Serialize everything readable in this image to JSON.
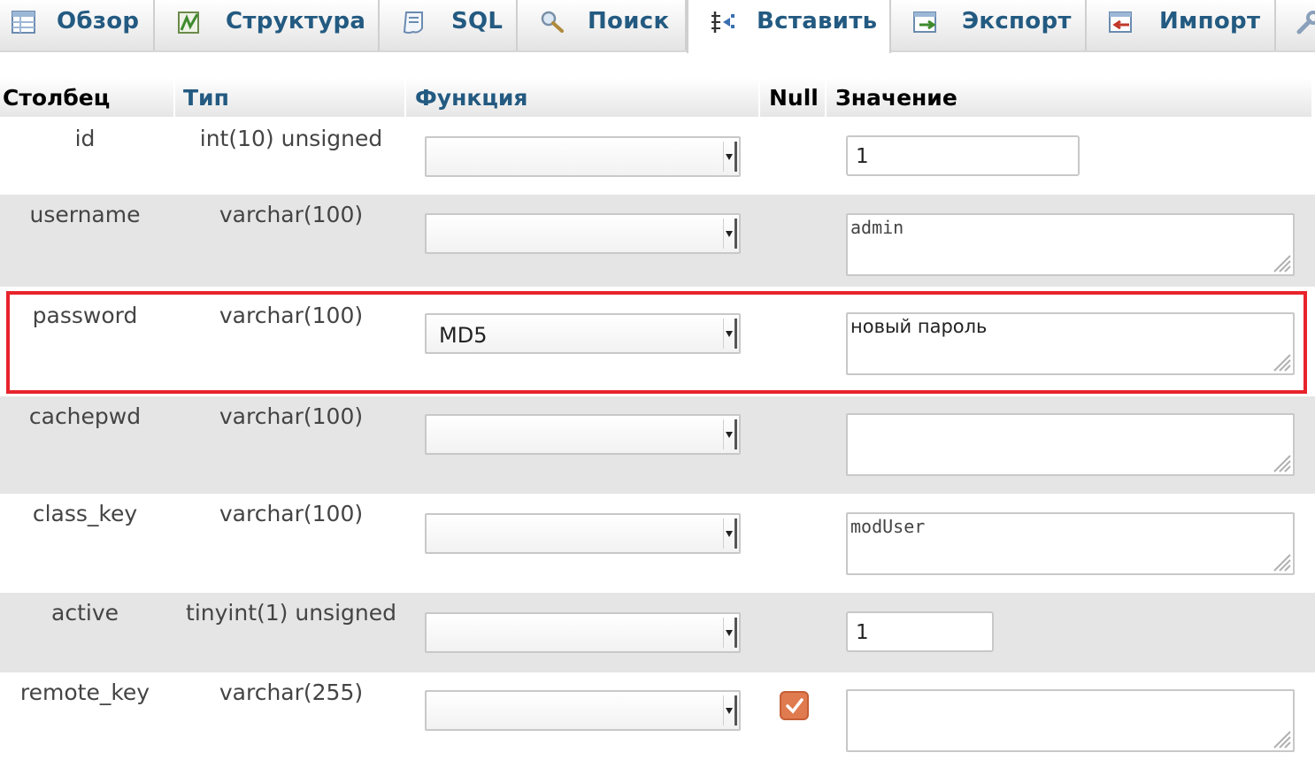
{
  "tabs": [
    {
      "label": "Обзор",
      "icon": "table-browse-icon",
      "active": false
    },
    {
      "label": "Структура",
      "icon": "structure-icon",
      "active": false
    },
    {
      "label": "SQL",
      "icon": "sql-document-icon",
      "active": false
    },
    {
      "label": "Поиск",
      "icon": "search-magnifier-icon",
      "active": false
    },
    {
      "label": "Вставить",
      "icon": "insert-row-icon",
      "active": true
    },
    {
      "label": "Экспорт",
      "icon": "export-icon",
      "active": false
    },
    {
      "label": "Импорт",
      "icon": "import-icon",
      "active": false
    },
    {
      "label": "",
      "icon": "wrench-icon",
      "active": false
    }
  ],
  "table_header": {
    "column": "Столбец",
    "type": "Тип",
    "function": "Функция",
    "null": "Null",
    "value": "Значение"
  },
  "rows": [
    {
      "column": "id",
      "type": "int(10) unsigned",
      "function": "",
      "null_checked": false,
      "value": "1",
      "input": "text"
    },
    {
      "column": "username",
      "type": "varchar(100)",
      "function": "",
      "null_checked": false,
      "value": "admin",
      "input": "textarea"
    },
    {
      "column": "password",
      "type": "varchar(100)",
      "function": "MD5",
      "null_checked": false,
      "value": "новый пароль",
      "input": "textarea",
      "highlighted": true
    },
    {
      "column": "cachepwd",
      "type": "varchar(100)",
      "function": "",
      "null_checked": false,
      "value": "",
      "input": "textarea"
    },
    {
      "column": "class_key",
      "type": "varchar(100)",
      "function": "",
      "null_checked": false,
      "value": "modUser",
      "input": "textarea"
    },
    {
      "column": "active",
      "type": "tinyint(1) unsigned",
      "function": "",
      "null_checked": false,
      "value": "1",
      "input": "text"
    },
    {
      "column": "remote_key",
      "type": "varchar(255)",
      "function": "",
      "null_checked": true,
      "value": "",
      "input": "textarea"
    }
  ],
  "colors": {
    "link_blue": "#235a81",
    "row_alt": "#e5e5e5",
    "highlight_red": "#e8242c",
    "checkbox_orange": "#e07a4f"
  }
}
